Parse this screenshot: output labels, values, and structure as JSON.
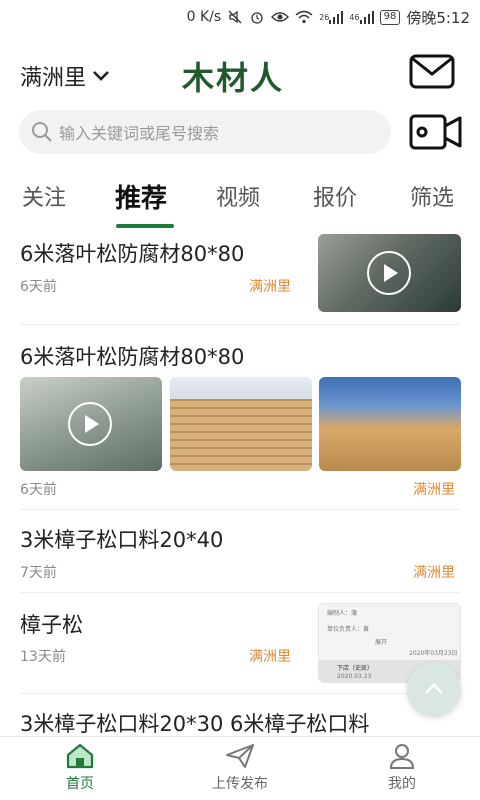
{
  "status_bar": {
    "network_speed": "0 K/s",
    "signal_1": "26",
    "signal_2": "46",
    "battery": "98",
    "time": "傍晚5:12"
  },
  "header": {
    "city": "满洲里",
    "logo_text": "木材人",
    "mail_icon": "mail-icon",
    "video_icon": "video-camera-icon"
  },
  "search": {
    "placeholder": "输入关键词或尾号搜索"
  },
  "tabs": [
    {
      "label": "关注",
      "active": false
    },
    {
      "label": "推荐",
      "active": true
    },
    {
      "label": "视频",
      "active": false
    },
    {
      "label": "报价",
      "active": false
    },
    {
      "label": "筛选",
      "active": false
    }
  ],
  "feed": [
    {
      "title": "6米落叶松防腐材80*80",
      "time": "6天前",
      "location": "满洲里"
    },
    {
      "title": "6米落叶松防腐材80*80",
      "time": "6天前",
      "location": "满洲里"
    },
    {
      "title": "3米樟子松口料20*40",
      "time": "7天前",
      "location": "满洲里"
    },
    {
      "title": "樟子松",
      "time": "13天前",
      "location": "满洲里",
      "doc_thumb": {
        "line1": "编制人：蒲",
        "line2": "单位负责人：黄",
        "expand": "展开",
        "date": "2020年03月23日",
        "shop": "下店（史凯）",
        "date2": "2020.03.23"
      }
    },
    {
      "title": "3米樟子松口料20*30   6米樟子松口料"
    }
  ],
  "bottom_nav": [
    {
      "label": "首页",
      "icon": "home-icon",
      "active": true
    },
    {
      "label": "上传发布",
      "icon": "send-icon",
      "active": false
    },
    {
      "label": "我的",
      "icon": "user-icon",
      "active": false
    }
  ],
  "colors": {
    "brand_green": "#1f5a2c",
    "accent_green": "#1f7a3a",
    "location_orange": "#e08a2e"
  }
}
